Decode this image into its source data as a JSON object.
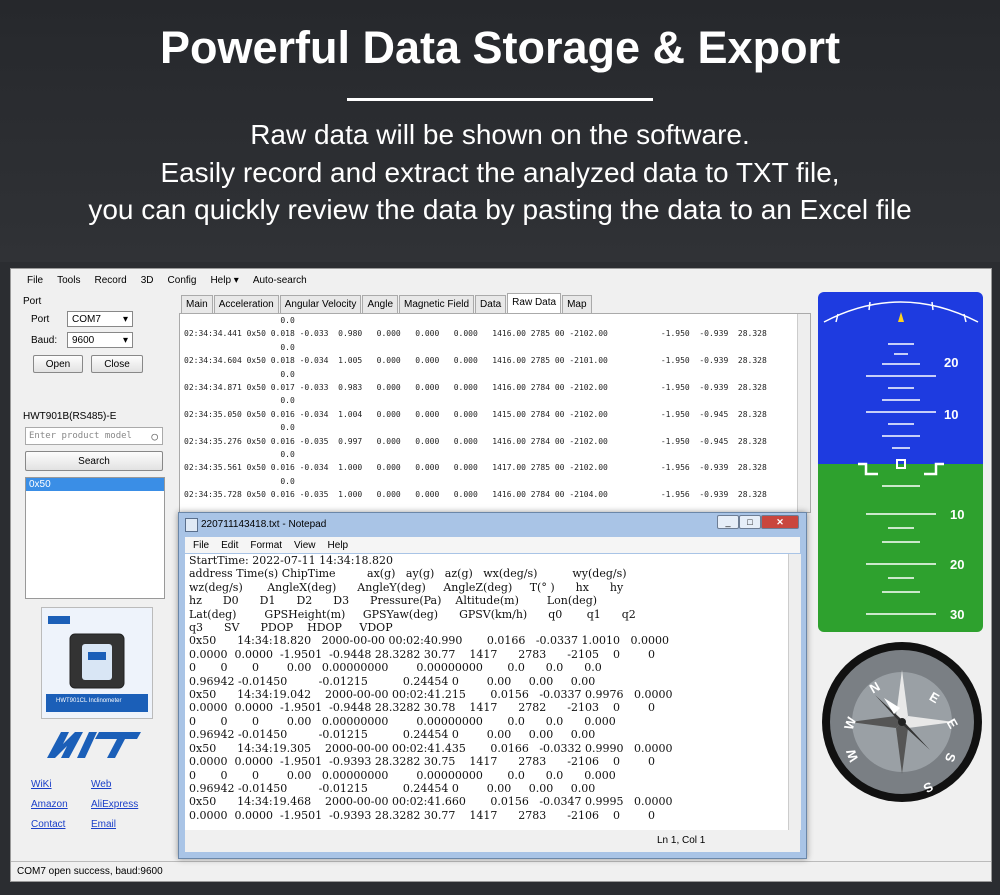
{
  "hero": {
    "title": "Powerful Data Storage & Export",
    "lines": [
      "Raw data will be shown on the software.",
      "Easily record and extract the analyzed data to TXT file,",
      "you can quickly review the data by pasting the data to an Excel file"
    ]
  },
  "menu": [
    "File",
    "Tools",
    "Record",
    "3D",
    "Config",
    "Help ▾",
    "Auto-search"
  ],
  "left": {
    "group_label": "Port",
    "port_label": "Port",
    "port_value": "COM7",
    "baud_label": "Baud:",
    "baud_value": "9600",
    "open_label": "Open",
    "close_label": "Close",
    "model": "HWT901B(RS485)-E",
    "search_placeholder": "Enter product model",
    "search_label": "Search",
    "device_item": "0x50",
    "device_caption": "HWT901CL Inclinometer",
    "logo_text": "WIT",
    "links": [
      "WiKi",
      "Web",
      "Amazon",
      "AliExpress",
      "Contact",
      "Email"
    ]
  },
  "tabs": [
    "Main",
    "Acceleration",
    "Angular Velocity",
    "Angle",
    "Magnetic Field",
    "Data",
    "Raw Data",
    "Map"
  ],
  "raw_lines": [
    "                    0.0",
    "02:34:34.441 0x50 0.018 -0.033  0.980   0.000   0.000   0.000   1416.00 2785 00 -2102.00           -1.950  -0.939  28.328",
    "                    0.0",
    "02:34:34.604 0x50 0.018 -0.034  1.005   0.000   0.000   0.000   1416.00 2785 00 -2101.00           -1.950  -0.939  28.328",
    "                    0.0",
    "02:34:34.871 0x50 0.017 -0.033  0.983   0.000   0.000   0.000   1416.00 2784 00 -2102.00           -1.950  -0.939  28.328",
    "                    0.0",
    "02:34:35.050 0x50 0.016 -0.034  1.004   0.000   0.000   0.000   1415.00 2784 00 -2102.00           -1.950  -0.945  28.328",
    "                    0.0",
    "02:34:35.276 0x50 0.016 -0.035  0.997   0.000   0.000   0.000   1416.00 2784 00 -2102.00           -1.950  -0.945  28.328",
    "                    0.0",
    "02:34:35.561 0x50 0.016 -0.034  1.000   0.000   0.000   0.000   1417.00 2785 00 -2102.00           -1.956  -0.939  28.328",
    "                    0.0",
    "02:34:35.728 0x50 0.016 -0.035  1.000   0.000   0.000   0.000   1416.00 2784 00 -2104.00           -1.956  -0.939  28.328"
  ],
  "notepad": {
    "title": "220711143418.txt - Notepad",
    "menu": [
      "File",
      "Edit",
      "Format",
      "View",
      "Help"
    ],
    "status": "Ln 1, Col 1",
    "lines": [
      "StartTime: 2022-07-11 14:34:18.820",
      "address Time(s) ChipTime         ax(g)   ay(g)   az(g)   wx(deg/s)          wy(deg/s)",
      "wz(deg/s)       AngleX(deg)      AngleY(deg)     AngleZ(deg)     T(° )      hx      hy",
      "hz      D0      D1      D2      D3      Pressure(Pa)    Altitude(m)        Lon(deg)",
      "Lat(deg)        GPSHeight(m)     GPSYaw(deg)      GPSV(km/h)      q0       q1      q2",
      "q3      SV      PDOP    HDOP     VDOP",
      "0x50      14:34:18.820   2000-00-00 00:02:40.990       0.0166   -0.0337 1.0010   0.0000",
      "0.0000  0.0000  -1.9501  -0.9448 28.3282 30.77    1417      2783      -2105    0        0",
      "0       0       0        0.00   0.00000000        0.00000000       0.0      0.0      0.0",
      "0.96942 -0.01450         -0.01215          0.24454 0        0.00     0.00     0.00",
      "0x50      14:34:19.042    2000-00-00 00:02:41.215       0.0156   -0.0337 0.9976   0.0000",
      "0.0000  0.0000  -1.9501  -0.9448 28.3282 30.78    1417      2782      -2103    0        0",
      "0       0       0        0.00   0.00000000        0.00000000       0.0      0.0      0.000",
      "0.96942 -0.01450         -0.01215          0.24454 0        0.00     0.00     0.00",
      "0x50      14:34:19.305    2000-00-00 00:02:41.435       0.0166   -0.0332 0.9990   0.0000",
      "0.0000  0.0000  -1.9501  -0.9393 28.3282 30.75    1417      2783      -2106    0        0",
      "0       0       0        0.00   0.00000000        0.00000000       0.0      0.0      0.000",
      "0.96942 -0.01450         -0.01215          0.24454 0        0.00     0.00     0.00",
      "0x50      14:34:19.468    2000-00-00 00:02:41.660       0.0156   -0.0347 0.9995   0.0000",
      "0.0000  0.0000  -1.9501  -0.9393 28.3282 30.77    1417      2783      -2106    0        0"
    ]
  },
  "gauge": {
    "labels_sky": [
      "20",
      "10"
    ],
    "labels_ground": [
      "10",
      "20",
      "30"
    ]
  },
  "compass": {
    "letters": [
      "N",
      "E",
      "E",
      "S",
      "S",
      "W",
      "W"
    ]
  },
  "status": "COM7 open success, baud:9600"
}
